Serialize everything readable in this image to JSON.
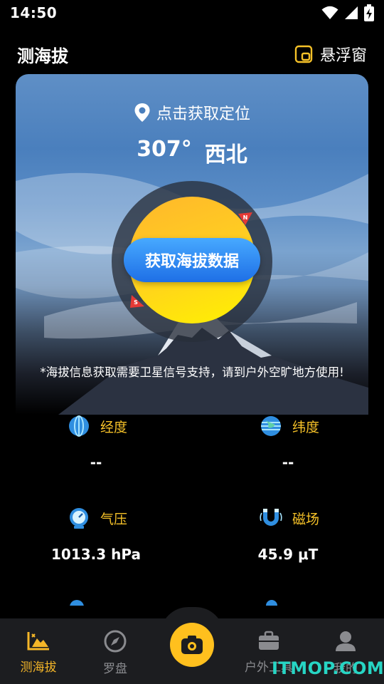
{
  "status": {
    "time": "14:50"
  },
  "header": {
    "title": "测海拔",
    "float_label": "悬浮窗"
  },
  "hero": {
    "location": "点击获取定位",
    "degree": "307°",
    "direction": "西北",
    "fetch_button": "获取海拔数据",
    "compass_n": "N",
    "compass_s": "S",
    "note": "*海拔信息获取需要卫星信号支持，请到户外空旷地方使用!"
  },
  "grid": {
    "longitude": {
      "label": "经度",
      "value": "--"
    },
    "latitude": {
      "label": "纬度",
      "value": "--"
    },
    "pressure": {
      "label": "气压",
      "value": "1013.3 hPa"
    },
    "magnetic": {
      "label": "磁场",
      "value": "45.9 μT"
    }
  },
  "nav": {
    "items": [
      {
        "label": "测海拔"
      },
      {
        "label": "罗盘"
      },
      {
        "label": "户外工具"
      },
      {
        "label": "我的"
      }
    ]
  },
  "watermark": "ITMOP.COM",
  "colors": {
    "accent": "#f5c128",
    "button_blue": "#2a86f2",
    "compass_yellow": "#ffd21c",
    "nav_bg": "#1c1d20"
  }
}
